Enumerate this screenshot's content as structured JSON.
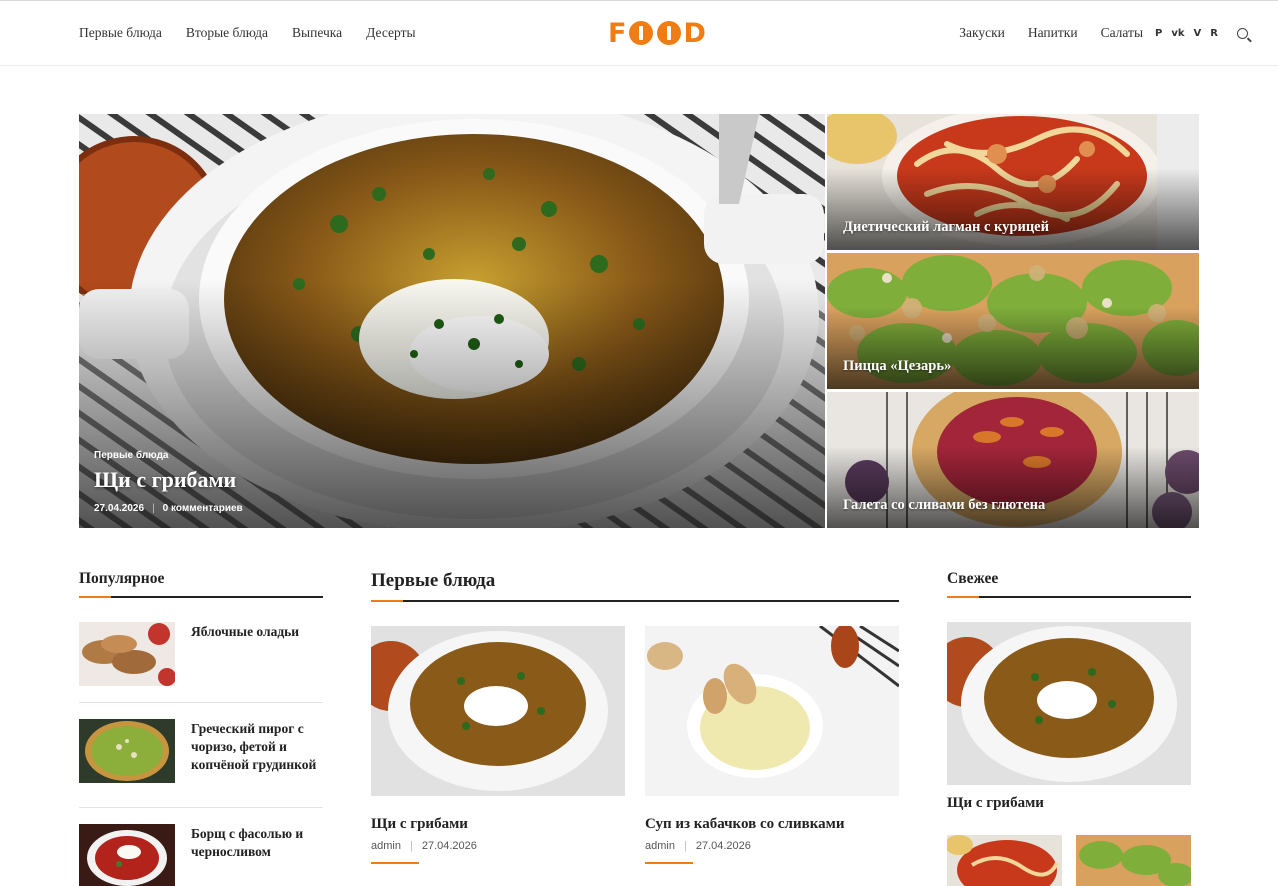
{
  "header": {
    "nav_left": [
      "Первые блюда",
      "Вторые блюда",
      "Выпечка",
      "Десерты"
    ],
    "nav_right": [
      "Закуски",
      "Напитки",
      "Салаты"
    ],
    "logo_text": "FOOD",
    "socials": {
      "pinterest": "P",
      "vk": "vk",
      "vimeo": "V",
      "reddit": "R"
    }
  },
  "hero": {
    "category": "Первые блюда",
    "title": "Щи с грибами",
    "date": "27.04.2026",
    "comments": "0 комментариев"
  },
  "featured": [
    {
      "title": "Диетический лагман с курицей"
    },
    {
      "title": "Пицца «Цезарь»"
    },
    {
      "title": "Галета со сливами без глютена"
    }
  ],
  "popular": {
    "heading": "Популярное",
    "items": [
      {
        "title": "Яблочные оладьи"
      },
      {
        "title": "Греческий пирог с чоризо, фетой и копчёной грудинкой"
      },
      {
        "title": "Борщ с фасолью и черносливом"
      }
    ]
  },
  "section": {
    "heading": "Первые блюда",
    "posts": [
      {
        "title": "Щи с грибами",
        "author": "admin",
        "date": "27.04.2026"
      },
      {
        "title": "Суп из кабачков со сливками",
        "author": "admin",
        "date": "27.04.2026"
      }
    ]
  },
  "fresh": {
    "heading": "Свежее",
    "title": "Щи с грибами"
  },
  "colors": {
    "accent": "#f07d14",
    "text": "#222222"
  }
}
